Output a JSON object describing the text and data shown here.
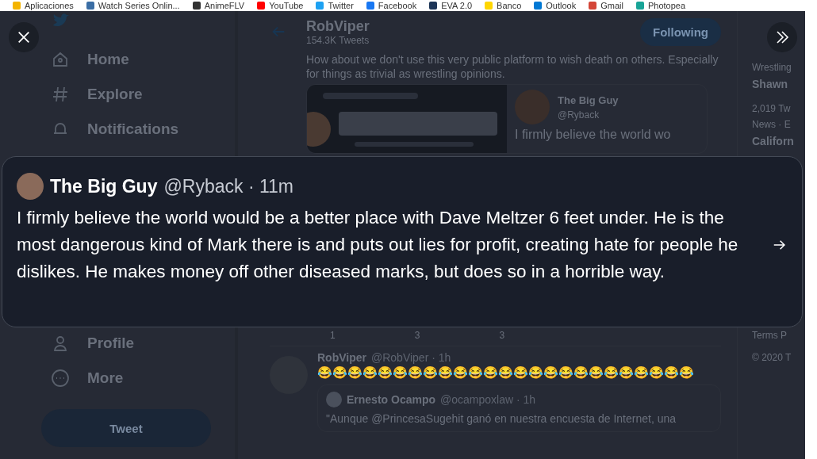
{
  "bookmarks": [
    {
      "label": "Aplicaciones",
      "color": "#f4b400"
    },
    {
      "label": "Watch Series Onlin...",
      "color": "#3b6ea5"
    },
    {
      "label": "AnimeFLV",
      "color": "#333333"
    },
    {
      "label": "YouTube",
      "color": "#ff0000"
    },
    {
      "label": "Twitter",
      "color": "#1da1f2"
    },
    {
      "label": "Facebook",
      "color": "#1877f2"
    },
    {
      "label": "EVA 2.0",
      "color": "#1d3557"
    },
    {
      "label": "Banco",
      "color": "#ffd600"
    },
    {
      "label": "Outlook",
      "color": "#0078d4"
    },
    {
      "label": "Gmail",
      "color": "#d44638"
    },
    {
      "label": "Photopea",
      "color": "#18a497"
    }
  ],
  "sidebar": {
    "items": [
      {
        "label": "Home"
      },
      {
        "label": "Explore"
      },
      {
        "label": "Notifications"
      },
      {
        "label": "Profile"
      },
      {
        "label": "More"
      }
    ],
    "tweet_button": "Tweet"
  },
  "profile_header": {
    "name": "RobViper",
    "tweet_count": "154.3K Tweets",
    "follow_button": "Following"
  },
  "main_tweet": {
    "text": "How about we don't use this very public platform to wish death on others. Especially for things as trivial as wrestling opinions.",
    "card": {
      "name": "The Big Guy",
      "handle": "@Ryback",
      "text": "I firmly believe the world wo"
    },
    "counts": [
      "1",
      "3",
      "3"
    ]
  },
  "reply": {
    "name": "RobViper",
    "meta": "@RobViper · 1h",
    "text": "😂😂😂😂😂😂😂😂😂😂😂😂😂😂😂😂😂😂😂😂😂😂😂😂😂",
    "quote": {
      "name": "Ernesto Ocampo",
      "meta": "@ocampoxlaw · 1h",
      "text": "\"Aunque @PrincesaSugehit ganó en nuestra encuesta de Internet, una"
    }
  },
  "trends": [
    {
      "kind": "label",
      "text": "Wrestling"
    },
    {
      "kind": "title",
      "text": "Shawn"
    },
    {
      "kind": "label",
      "text": "2,019 Tw"
    },
    {
      "kind": "label",
      "text": "News · E"
    },
    {
      "kind": "title",
      "text": "Californ"
    }
  ],
  "footer": [
    "Terms  P",
    "© 2020 T"
  ],
  "overlay_tweet": {
    "name": "The Big Guy",
    "meta": "@Ryback · 11m",
    "text": "I firmly believe the world would be a better place with Dave Meltzer 6 feet under. He is the most dangerous kind of Mark there is and puts out lies for profit, creating hate for people he dislikes. He makes money off other diseased marks, but does so in a horrible way."
  }
}
